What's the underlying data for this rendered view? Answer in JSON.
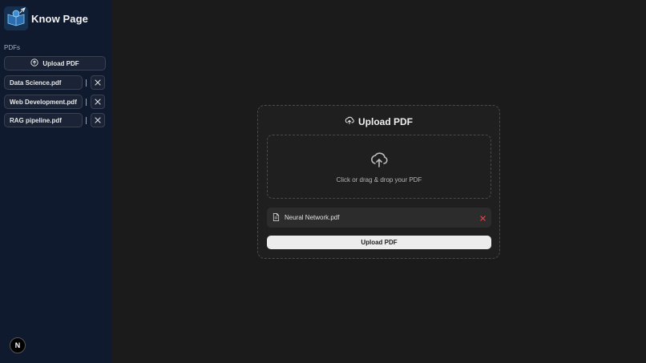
{
  "sidebar": {
    "brand_title": "Know Page",
    "section_label": "PDFs",
    "upload_label": "Upload PDF",
    "files": [
      "Data Science.pdf",
      "Web Development.pdf",
      "RAG pipeline.pdf"
    ],
    "avatar_letter": "N"
  },
  "main": {
    "card_title": "Upload PDF",
    "drop_text": "Click or drag & drop your PDF",
    "selected_file": "Neural Network.pdf",
    "upload_button": "Upload PDF"
  },
  "icons": {
    "logo": "book-brain-logo",
    "upload_side": "upload-circle-icon",
    "remove_file": "close-icon",
    "card_title": "cloud-upload-icon",
    "drop_zone": "cloud-upload-icon",
    "file": "file-icon",
    "remove_selected": "close-icon"
  },
  "colors": {
    "sidebar_bg": "#0f1a2e",
    "main_bg": "#1b1b1b",
    "remove_accent": "#e5484d",
    "button_bg": "#ececec"
  }
}
